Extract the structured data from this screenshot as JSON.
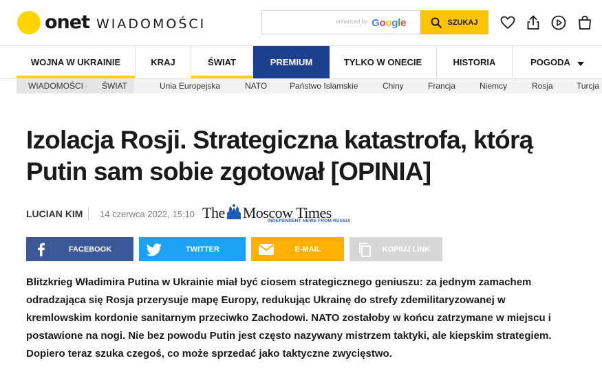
{
  "header": {
    "logo_brand": "onet",
    "logo_section": "WIADOMOŚCI",
    "search": {
      "value": "",
      "enhanced_by": "enhanced by",
      "google": [
        "G",
        "o",
        "o",
        "g",
        "l",
        "e"
      ],
      "button_label": "SZUKAJ"
    },
    "icons": [
      "heart-icon",
      "share-upload-icon",
      "play-icon",
      "bag-icon"
    ],
    "colors": {
      "brand_yellow": "#ffd400",
      "search_button": "#ffc400"
    }
  },
  "nav": {
    "items": [
      {
        "label": "WOJNA W UKRAINIE",
        "active": true
      },
      {
        "label": "KRAJ",
        "active": false
      },
      {
        "label": "ŚWIAT",
        "active": true
      },
      {
        "label": "PREMIUM",
        "active": false,
        "premium": true
      },
      {
        "label": "TYLKO W ONECIE",
        "active": false
      },
      {
        "label": "HISTORIA",
        "active": false
      },
      {
        "label": "POGODA",
        "active": false,
        "dropdown": true
      }
    ],
    "colors": {
      "premium_bg": "#1e3f8f",
      "active_underline": "#ffd400"
    }
  },
  "breadcrumb": {
    "items": [
      "WIADOMOŚCI",
      "ŚWIAT"
    ],
    "tags": [
      "Unia Europejska",
      "NATO",
      "Państwo Islamskie",
      "Chiny",
      "Francja",
      "Niemcy",
      "Rosja",
      "Turcja"
    ]
  },
  "article": {
    "title_line1": "Izolacja Rosji. Strategiczna katastrofa, którą",
    "title_line2": "Putin sam sobie zgotował [OPINIA]",
    "author": "LUCIAN KIM",
    "date": "14 czerwca 2022, 15:10",
    "source_logo": {
      "name_pre": "The",
      "name_post": "Moscow Times",
      "tagline": "INDEPENDENT NEWS FROM RUSSIA"
    },
    "share": {
      "facebook": "FACEBOOK",
      "twitter": "TWITTER",
      "email": "E-MAIL",
      "copy": "KOPIUJ LINK"
    },
    "lead_lines": [
      "Blitzkrieg Władimira Putina w Ukrainie miał być ciosem strategicznego geniuszu: za jednym zamachem",
      "odradzająca się Rosja przerysuje mapę Europy, redukując Ukrainę do strefy zdemilitaryzowanej w",
      "kremlowskim kordonie sanitarnym przeciwko Zachodowi. NATO zostałoby w końcu zatrzymane w miejscu i",
      "postawione na nogi. Nie bez powodu Putin jest często nazywany mistrzem taktyki, ale kiepskim strategiem.",
      "Dopiero teraz szuka czegoś, co może sprzedać jako taktyczne zwycięstwo."
    ],
    "colors": {
      "facebook": "#3b5998",
      "twitter": "#1da1f2",
      "email": "#ffb000",
      "copy": "#d7d7d7"
    }
  }
}
